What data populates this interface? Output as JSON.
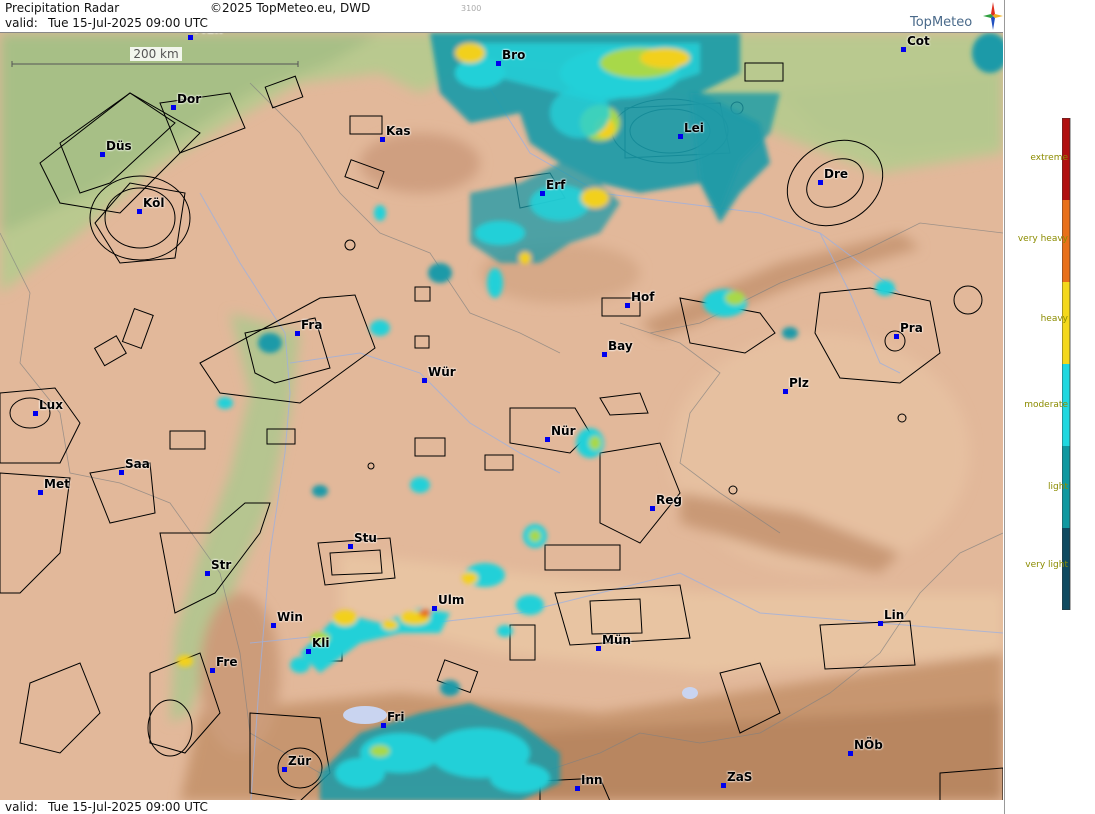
{
  "header": {
    "title": "Precipitation Radar",
    "copyright": "©2025 TopMeteo.eu, DWD",
    "code": "3100",
    "valid_label": "valid:",
    "valid_time": "Tue  15-Jul-2025 09:00 UTC",
    "logo": "TopMeteo"
  },
  "footer": {
    "valid_label": "valid:",
    "valid_time": "Tue  15-Jul-2025 09:00 UTC"
  },
  "scale_bar": {
    "label": "200 km"
  },
  "legend": {
    "items": [
      {
        "label": "extreme",
        "color": "#b01010"
      },
      {
        "label": "very heavy",
        "color": "#e8701a"
      },
      {
        "label": "heavy",
        "color": "#f4d81c"
      },
      {
        "label": "moderate",
        "color": "#20d8e0"
      },
      {
        "label": "light",
        "color": "#1098a0"
      },
      {
        "label": "very light",
        "color": "#104a60"
      }
    ]
  },
  "cities": [
    {
      "name": "Mün",
      "id": "mun-top"
    },
    {
      "name": "Bro",
      "id": "bro"
    },
    {
      "name": "Cot",
      "id": "cot"
    },
    {
      "name": "Dor",
      "id": "dor"
    },
    {
      "name": "Kas",
      "id": "kas"
    },
    {
      "name": "Lei",
      "id": "lei"
    },
    {
      "name": "Düs",
      "id": "dus"
    },
    {
      "name": "Erf",
      "id": "erf"
    },
    {
      "name": "Dre",
      "id": "dre"
    },
    {
      "name": "Köl",
      "id": "kol"
    },
    {
      "name": "Hof",
      "id": "hof"
    },
    {
      "name": "Fra",
      "id": "fra"
    },
    {
      "name": "Pra",
      "id": "pra"
    },
    {
      "name": "Bay",
      "id": "bay"
    },
    {
      "name": "Wür",
      "id": "wur"
    },
    {
      "name": "Plz",
      "id": "plz"
    },
    {
      "name": "Lux",
      "id": "lux"
    },
    {
      "name": "Nür",
      "id": "nur"
    },
    {
      "name": "Saa",
      "id": "saa"
    },
    {
      "name": "Met",
      "id": "met"
    },
    {
      "name": "Reg",
      "id": "reg"
    },
    {
      "name": "Stu",
      "id": "stu"
    },
    {
      "name": "Str",
      "id": "str"
    },
    {
      "name": "Ulm",
      "id": "ulm"
    },
    {
      "name": "Win",
      "id": "win"
    },
    {
      "name": "Lin",
      "id": "lin"
    },
    {
      "name": "Kli",
      "id": "kli"
    },
    {
      "name": "Mün",
      "id": "mun"
    },
    {
      "name": "Fre",
      "id": "fre"
    },
    {
      "name": "Fri",
      "id": "fri"
    },
    {
      "name": "NÖb",
      "id": "nob"
    },
    {
      "name": "Zür",
      "id": "zur"
    },
    {
      "name": "ZaS",
      "id": "zas"
    },
    {
      "name": "Inn",
      "id": "inn"
    }
  ]
}
